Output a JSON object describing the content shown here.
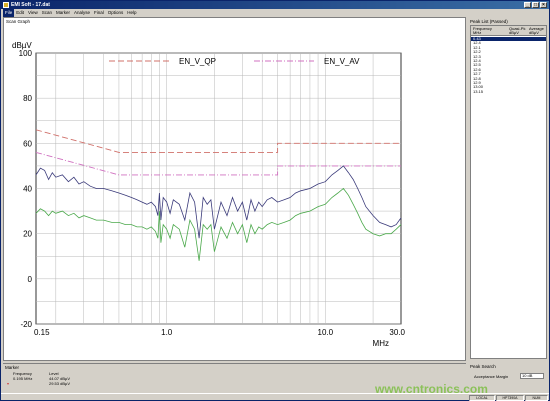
{
  "window": {
    "title": "EMI Soft - 17.dat"
  },
  "menu": [
    "File",
    "Edit",
    "View",
    "Scan",
    "Marker",
    "Analyse",
    "Final",
    "Options",
    "Help"
  ],
  "scan_graph": {
    "caption": "Scan Graph"
  },
  "chart_data": {
    "type": "line",
    "xscale": "log",
    "xlim": [
      0.15,
      30.0
    ],
    "ylim": [
      -20,
      100
    ],
    "yticks": [
      -20,
      0,
      20,
      40,
      60,
      80,
      100
    ],
    "xtick_labels": [
      "0.15",
      "1.0",
      "10.0",
      "30.0"
    ],
    "xtick_values": [
      0.15,
      1.0,
      10.0,
      30.0
    ],
    "ylabel": "dBµV",
    "xlabel": "MHz",
    "grid": true,
    "legend_position": "top",
    "series": [
      {
        "name": "EN_V_QP",
        "color": "#d0706a",
        "dash": "dash",
        "x": [
          0.15,
          0.5,
          0.5,
          5.0,
          5.0,
          30.0
        ],
        "y": [
          66,
          56,
          56,
          56,
          60,
          60
        ]
      },
      {
        "name": "EN_V_AV",
        "color": "#d070c0",
        "dash": "dashdot",
        "x": [
          0.15,
          0.5,
          0.5,
          5.0,
          5.0,
          30.0
        ],
        "y": [
          56,
          46,
          46,
          46,
          50,
          50
        ]
      },
      {
        "name": "",
        "color": "#3a3a7a",
        "dash": "solid",
        "x": [
          0.15,
          0.16,
          0.17,
          0.18,
          0.19,
          0.2,
          0.22,
          0.24,
          0.26,
          0.28,
          0.3,
          0.33,
          0.36,
          0.4,
          0.45,
          0.5,
          0.55,
          0.6,
          0.65,
          0.7,
          0.75,
          0.8,
          0.85,
          0.88,
          0.9,
          0.92,
          0.95,
          1.0,
          1.05,
          1.1,
          1.2,
          1.3,
          1.4,
          1.5,
          1.6,
          1.7,
          1.8,
          1.9,
          2.0,
          2.2,
          2.4,
          2.6,
          2.8,
          3.0,
          3.2,
          3.4,
          3.6,
          3.8,
          4.0,
          4.3,
          4.6,
          5.0,
          5.5,
          6.0,
          6.5,
          7.0,
          8.0,
          9.0,
          10.0,
          11.0,
          12.0,
          13.0,
          14.0,
          15.0,
          16.0,
          17.0,
          18.0,
          20.0,
          22.0,
          24.0,
          26.0,
          28.0,
          30.0
        ],
        "y": [
          46,
          49,
          48,
          44,
          47,
          45,
          46,
          43,
          45,
          42,
          43,
          41,
          40,
          40,
          39,
          38,
          37,
          36,
          35,
          34,
          33,
          34,
          32,
          28,
          38,
          26,
          36,
          34,
          29,
          35,
          33,
          26,
          38,
          34,
          18,
          36,
          33,
          35,
          22,
          34,
          28,
          36,
          30,
          34,
          26,
          35,
          30,
          34,
          32,
          35,
          36,
          34,
          35,
          36,
          38,
          39,
          40,
          42,
          43,
          46,
          48,
          50,
          47,
          44,
          40,
          36,
          32,
          28,
          25,
          24,
          23,
          24,
          27
        ]
      },
      {
        "name": "",
        "color": "#4aa84a",
        "dash": "solid",
        "x": [
          0.15,
          0.16,
          0.17,
          0.18,
          0.19,
          0.2,
          0.22,
          0.24,
          0.26,
          0.28,
          0.3,
          0.33,
          0.36,
          0.4,
          0.45,
          0.5,
          0.55,
          0.6,
          0.65,
          0.7,
          0.75,
          0.8,
          0.85,
          0.88,
          0.9,
          0.92,
          0.95,
          1.0,
          1.05,
          1.1,
          1.2,
          1.3,
          1.4,
          1.5,
          1.6,
          1.7,
          1.8,
          1.9,
          2.0,
          2.2,
          2.4,
          2.6,
          2.8,
          3.0,
          3.2,
          3.4,
          3.6,
          3.8,
          4.0,
          4.3,
          4.6,
          5.0,
          5.5,
          6.0,
          6.5,
          7.0,
          8.0,
          9.0,
          10.0,
          11.0,
          12.0,
          13.0,
          14.0,
          15.0,
          16.0,
          17.0,
          18.0,
          20.0,
          22.0,
          24.0,
          26.0,
          28.0,
          30.0
        ],
        "y": [
          29,
          31,
          30,
          28,
          30,
          29,
          30,
          28,
          29,
          27,
          28,
          27,
          26,
          26,
          25,
          25,
          24,
          24,
          23,
          23,
          22,
          23,
          21,
          18,
          30,
          16,
          24,
          22,
          18,
          24,
          22,
          14,
          26,
          22,
          8,
          24,
          22,
          24,
          12,
          23,
          18,
          25,
          20,
          24,
          16,
          24,
          20,
          23,
          22,
          24,
          25,
          24,
          25,
          26,
          28,
          29,
          30,
          32,
          33,
          36,
          38,
          40,
          37,
          33,
          29,
          25,
          22,
          20,
          19,
          20,
          20,
          22,
          24
        ]
      }
    ]
  },
  "peak_list": {
    "caption": "Peak List (Passed)",
    "col_frequency": "Frequency",
    "col_frequency_unit": "MHz",
    "col_qp": "Quasi-Pk",
    "col_qp_unit": "dBµV",
    "col_av": "Average",
    "col_av_unit": "dBµV",
    "rows": [
      "0.43",
      "12.4",
      "12.1",
      "12.2",
      "12.3",
      "12.4",
      "12.5",
      "12.6",
      "12.7",
      "12.8",
      "12.9",
      "13.00",
      "13.15"
    ]
  },
  "marker": {
    "caption": "Marker",
    "frequency_label": "Frequency",
    "frequency_value": "0.195 MHz",
    "level_label": "Level",
    "level_value_1": "44.07 dBµV",
    "level_value_2": "29.53 dBµV"
  },
  "peak_search": {
    "caption": "Peak Search",
    "label": "Acceptance Margin",
    "value": "10 dB"
  },
  "status": {
    "cell1": "LOCAL",
    "cell2": "HP7390A",
    "cell3": "NUM"
  },
  "watermark": "www.cntronics.com"
}
